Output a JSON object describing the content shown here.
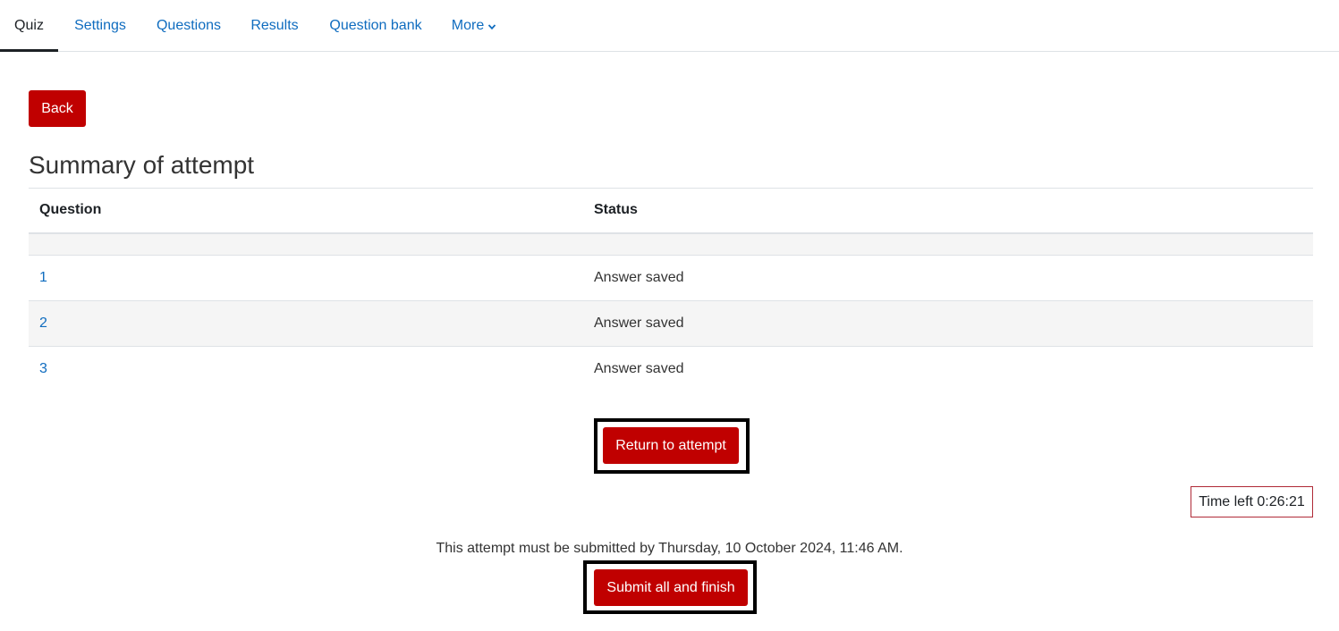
{
  "nav": {
    "tabs": [
      {
        "label": "Quiz",
        "active": true
      },
      {
        "label": "Settings",
        "active": false
      },
      {
        "label": "Questions",
        "active": false
      },
      {
        "label": "Results",
        "active": false
      },
      {
        "label": "Question bank",
        "active": false
      },
      {
        "label": "More",
        "active": false
      }
    ]
  },
  "back_button": {
    "label": "Back"
  },
  "page_title": "Summary of attempt",
  "table": {
    "headers": {
      "question": "Question",
      "status": "Status"
    },
    "rows": [
      {
        "question": "1",
        "status": "Answer saved"
      },
      {
        "question": "2",
        "status": "Answer saved"
      },
      {
        "question": "3",
        "status": "Answer saved"
      }
    ]
  },
  "return_button": {
    "label": "Return to attempt"
  },
  "timer": {
    "text": "Time left 0:26:21"
  },
  "deadline_text": "This attempt must be submitted by Thursday, 10 October 2024, 11:46 AM.",
  "submit_button": {
    "label": "Submit all and finish"
  },
  "colors": {
    "accent_red": "#c00000",
    "link_blue": "#0f6cbf",
    "timer_border": "#b02a37"
  },
  "icons": {
    "more_chevron": "chevron-down-icon"
  }
}
